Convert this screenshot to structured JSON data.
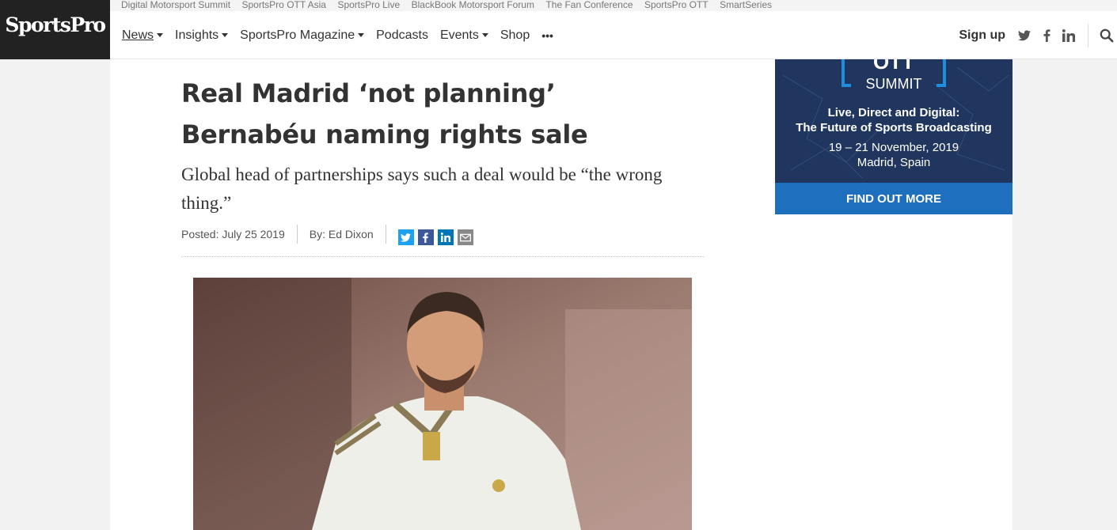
{
  "events_strip": [
    "Digital Motorsport Summit",
    "SportsPro OTT Asia",
    "SportsPro Live",
    "BlackBook Motorsport Forum",
    "The Fan Conference",
    "SportsPro OTT",
    "SmartSeries"
  ],
  "logo": "SportsPro",
  "nav": {
    "items": [
      {
        "label": "News",
        "dropdown": true
      },
      {
        "label": "Insights",
        "dropdown": true
      },
      {
        "label": "SportsPro Magazine",
        "dropdown": true
      },
      {
        "label": "Podcasts",
        "dropdown": false
      },
      {
        "label": "Events",
        "dropdown": true
      },
      {
        "label": "Shop",
        "dropdown": false
      }
    ],
    "more": "•••",
    "signup": "Sign up"
  },
  "article": {
    "headline": "Real Madrid ‘not planning’ Bernabéu naming rights sale",
    "standfirst": "Global head of partnerships says such a deal would be “the wrong thing.”",
    "posted": "Posted: July 25 2019",
    "author": "By: Ed Dixon"
  },
  "ad": {
    "logo_text": "OTT",
    "summit": "SUMMIT",
    "line1": "Live, Direct and Digital:",
    "line2": "The Future of Sports Broadcasting",
    "dates": "19 – 21 November, 2019",
    "location": "Madrid, Spain",
    "cta": "FIND OUT MORE"
  },
  "colors": {
    "header_dark": "#222222",
    "ad_navy": "#21365e",
    "ad_cta_blue": "#1f6fbf",
    "twitter": "#1da1f2",
    "facebook": "#3b5998",
    "linkedin": "#0077b5"
  },
  "icons": [
    "caret-down-icon",
    "twitter-icon",
    "facebook-icon",
    "linkedin-icon",
    "search-icon",
    "email-icon"
  ]
}
